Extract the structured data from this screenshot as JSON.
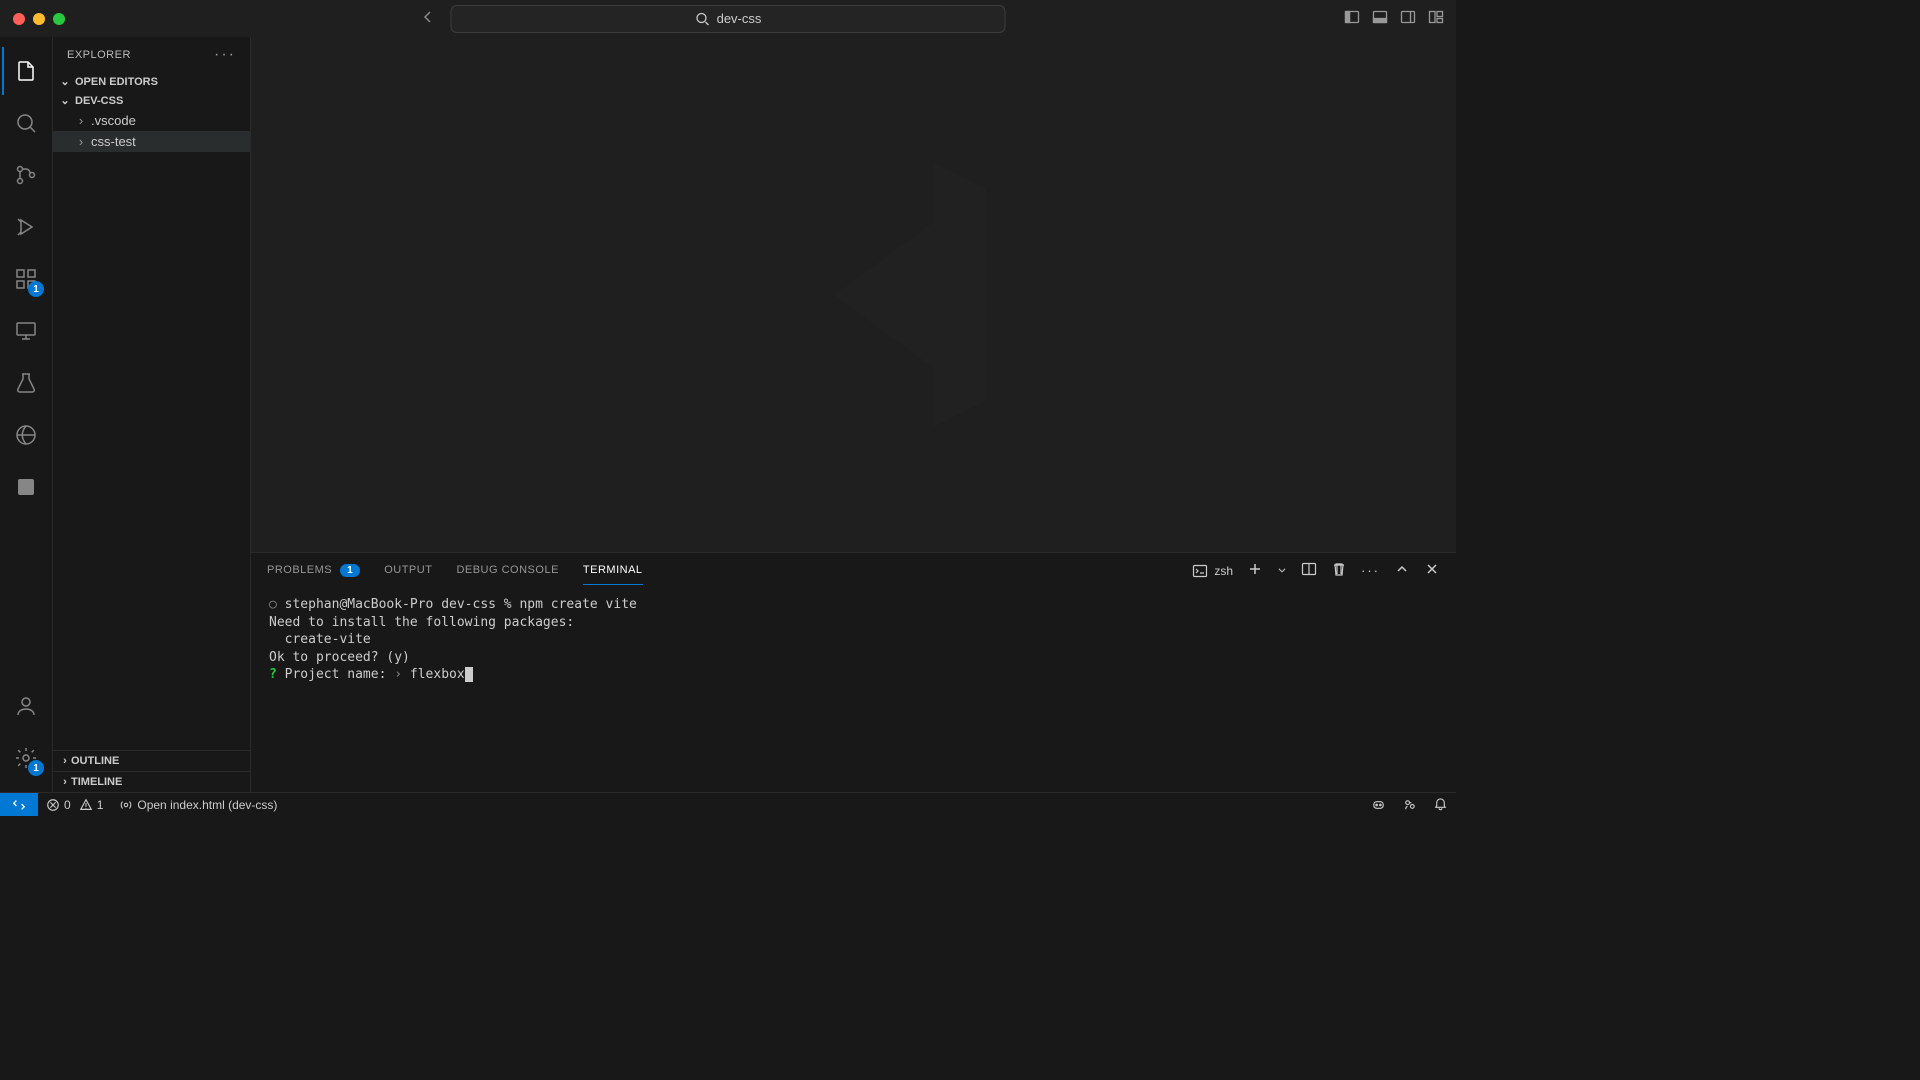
{
  "title_bar": {
    "search_text": "dev-css"
  },
  "activity_bar": {
    "extensions_badge": "1",
    "settings_badge": "1"
  },
  "sidebar": {
    "title": "EXPLORER",
    "open_editors_label": "OPEN EDITORS",
    "project_label": "DEV-CSS",
    "tree": [
      {
        "name": ".vscode"
      },
      {
        "name": "css-test"
      }
    ],
    "outline_label": "OUTLINE",
    "timeline_label": "TIMELINE"
  },
  "panel": {
    "tabs": {
      "problems": "PROBLEMS",
      "problems_count": "1",
      "output": "OUTPUT",
      "debug_console": "DEBUG CONSOLE",
      "terminal": "TERMINAL"
    },
    "shell": "zsh",
    "terminal_lines": {
      "l1_prefix": "○ ",
      "l1": "stephan@MacBook-Pro dev-css % npm create vite",
      "l2": "Need to install the following packages:",
      "l3": "  create-vite",
      "l4": "Ok to proceed? (y) ",
      "l5_q": "?",
      "l5_label": " Project name: ",
      "l5_arrow": "› ",
      "l5_input": "flexbox"
    }
  },
  "status_bar": {
    "errors": "0",
    "warnings": "1",
    "open_file": "Open index.html (dev-css)"
  }
}
